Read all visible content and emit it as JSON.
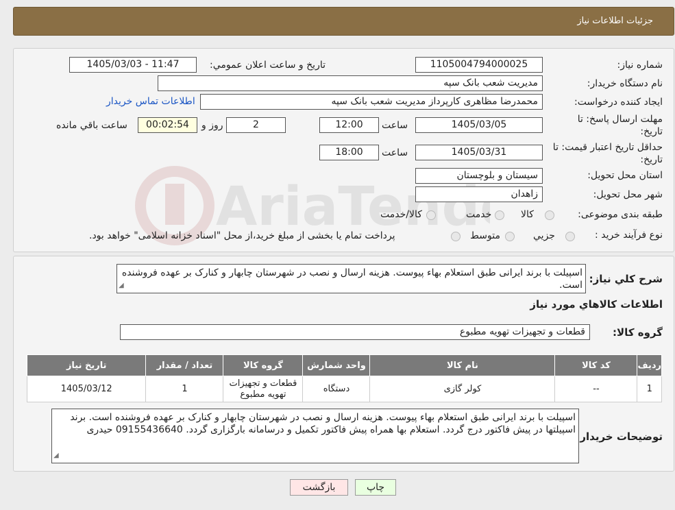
{
  "header": {
    "title": "جزئیات اطلاعات نیاز"
  },
  "watermark": {
    "text": "AriaTender.neT"
  },
  "form": {
    "need_number_label": "شماره نیاز:",
    "need_number": "1105004794000025",
    "announce_label": "تاریخ و ساعت اعلان عمومي:",
    "announce_value": "1405/03/03 - 11:47",
    "buyer_org_label": "نام دستگاه خریدار:",
    "buyer_org": "مدیریت شعب بانک سپه",
    "creator_label": "ایجاد کننده درخواست:",
    "creator": "محمدرضا مظاهری کارپرداز مدیریت شعب بانک سپه",
    "contact_link": "اطلاعات تماس خریدار",
    "deadline_label_1": "مهلت ارسال پاسخ: تا",
    "deadline_label_2": "تاریخ:",
    "deadline_date": "1405/03/05",
    "hour_label": "ساعت",
    "deadline_time": "12:00",
    "days_value": "2",
    "days_label": "روز و",
    "remaining_time": "00:02:54",
    "remaining_label": "ساعت باقي مانده",
    "validity_label_1": "حداقل تاریخ اعتبار قیمت: تا",
    "validity_label_2": "تاریخ:",
    "validity_date": "1405/03/31",
    "validity_time": "18:00",
    "province_label": "استان محل تحویل:",
    "province": "سیستان و بلوچستان",
    "city_label": "شهر محل تحویل:",
    "city": "زاهدان",
    "category_label": "طبقه بندی موضوعی:",
    "category_options": [
      "کالا",
      "خدمت",
      "کالا/خدمت"
    ],
    "process_label": "نوع فرآیند خرید :",
    "process_options": [
      "جزیي",
      "متوسط"
    ],
    "process_note": "پرداخت تمام یا بخشی از مبلغ خرید،از محل \"اسناد خزانه اسلامی\" خواهد بود."
  },
  "details": {
    "desc_label": "شرح کلي نياز:",
    "desc_text": "اسپیلت با برند ایرانی طبق استعلام بهاء پیوست. هزینه ارسال و نصب در شهرستان چابهار و کنارک بر عهده فروشنده است.",
    "goods_info_title": "اطلاعات کالاهاي مورد نياز",
    "goods_group_label": "گروه کالا:",
    "goods_group": "قطعات و تجهیزات تهویه مطبوع",
    "table_headers": [
      "رديف",
      "کد کالا",
      "نام کالا",
      "واحد شمارش",
      "گروه کالا",
      "تعداد / مقدار",
      "تاریخ نیاز"
    ],
    "rows": [
      [
        "1",
        "--",
        "کولر گازی",
        "دستگاه",
        "قطعات و تجهیزات تهویه مطبوع",
        "1",
        "1405/03/12"
      ]
    ],
    "buyer_notes_label": "توضيحات خريدار:",
    "buyer_notes": "اسپیلت با برند ایرانی طبق استعلام بهاء پیوست. هزینه ارسال و نصب در شهرستان چابهار و کنارک بر عهده فروشنده است. برند اسپیلتها در پیش فاکتور  درج گردد. استعلام بها همراه پیش فاکتور تکمیل و درسامانه بارگزاری گردد. 09155436640 حیدری"
  },
  "buttons": {
    "print": "چاپ",
    "back": "بازگشت"
  }
}
